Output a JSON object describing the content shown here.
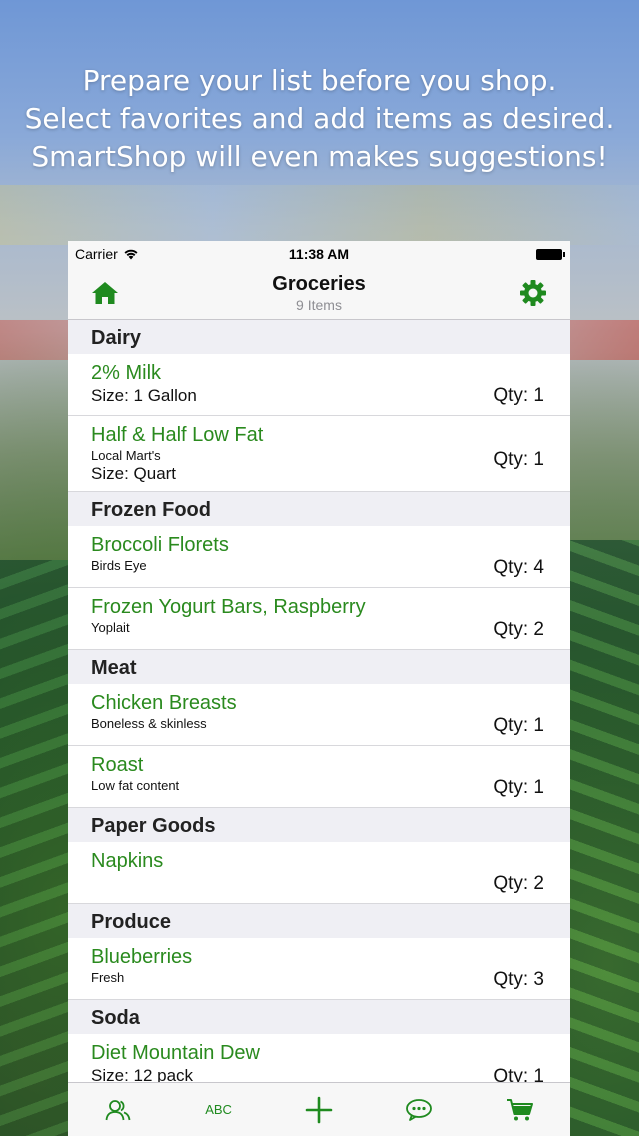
{
  "promo": {
    "line1": "Prepare your list before you shop.",
    "line2": "Select favorites and add items as desired.",
    "line3": "SmartShop will even makes suggestions!"
  },
  "status_bar": {
    "carrier": "Carrier",
    "time": "11:38 AM"
  },
  "nav": {
    "title": "Groceries",
    "subtitle": "9 Items",
    "left_icon": "home-icon",
    "right_icon": "gear-icon"
  },
  "colors": {
    "accent": "#2a8a1e"
  },
  "sections": [
    {
      "title": "Dairy",
      "items": [
        {
          "name": "2% Milk",
          "desc": "",
          "size": "Size: 1 Gallon",
          "qty": "Qty: 1"
        },
        {
          "name": "Half & Half Low Fat",
          "desc": "Local Mart's",
          "size": "Size: Quart",
          "qty": "Qty: 1"
        }
      ]
    },
    {
      "title": "Frozen Food",
      "items": [
        {
          "name": "Broccoli Florets",
          "desc": "Birds Eye",
          "size": "",
          "qty": "Qty: 4"
        },
        {
          "name": "Frozen Yogurt Bars, Raspberry",
          "desc": "Yoplait",
          "size": "",
          "qty": "Qty: 2"
        }
      ]
    },
    {
      "title": "Meat",
      "items": [
        {
          "name": "Chicken Breasts",
          "desc": "Boneless & skinless",
          "size": "",
          "qty": "Qty: 1"
        },
        {
          "name": "Roast",
          "desc": "Low fat content",
          "size": "",
          "qty": "Qty: 1"
        }
      ]
    },
    {
      "title": "Paper Goods",
      "items": [
        {
          "name": "Napkins",
          "desc": "",
          "size": "",
          "qty": "Qty: 2"
        }
      ]
    },
    {
      "title": "Produce",
      "items": [
        {
          "name": "Blueberries",
          "desc": "Fresh",
          "size": "",
          "qty": "Qty: 3"
        }
      ]
    },
    {
      "title": "Soda",
      "items": [
        {
          "name": "Diet Mountain Dew",
          "desc": "",
          "size": "Size: 12 pack",
          "qty": "Qty: 1"
        }
      ]
    }
  ],
  "tabbar": {
    "tabs": [
      {
        "icon": "people-icon"
      },
      {
        "label": "ABC"
      },
      {
        "icon": "plus-icon"
      },
      {
        "icon": "chat-bubble-icon"
      },
      {
        "icon": "cart-icon"
      }
    ]
  }
}
